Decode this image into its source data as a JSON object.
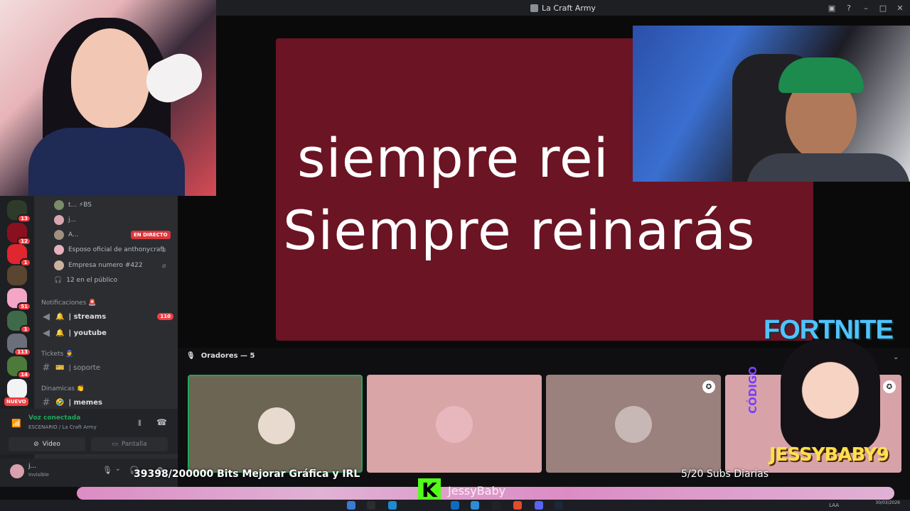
{
  "window": {
    "title": "La Craft Army"
  },
  "stage": {
    "lyric_line1": "siempre rei",
    "lyric_line2": "Siempre reinarás"
  },
  "guilds": [
    {
      "badge": "13"
    },
    {
      "badge": "12"
    },
    {
      "badge": "1"
    },
    {
      "badge": ""
    },
    {
      "badge": "51"
    },
    {
      "badge": "1"
    },
    {
      "badge": "113"
    },
    {
      "badge": "14"
    },
    {
      "badge": ""
    }
  ],
  "guild_new_label": "NUEVO",
  "voice_channel_users": [
    {
      "name": "t... ⚡BS"
    },
    {
      "name": "j..."
    },
    {
      "name": "A..."
    },
    {
      "name": "Esposo oficial de anthonycraft"
    },
    {
      "name": "Empresa numero #422"
    }
  ],
  "live_label": "EN DIRECTO",
  "audience_label": "12 en el público",
  "categories": {
    "notificaciones": "Notificaciones 🚨",
    "tickets": "Tickets 👮",
    "dinamicas": "Dinamicas 👏"
  },
  "channels": {
    "streams": {
      "name": "| streams",
      "count": "110"
    },
    "youtube": {
      "name": "| youtube"
    },
    "soporte": {
      "name": "| soporte"
    },
    "memes": {
      "name": "| memes"
    }
  },
  "voice_panel": {
    "status": "Voz conectada",
    "sub": "ESCENARIO / La Craft Army",
    "video_label": "Video",
    "screen_label": "Pantalla"
  },
  "user_panel": {
    "name": "j...",
    "status": "Invisible"
  },
  "speakers": {
    "header": "Oradores — 5"
  },
  "overlays": {
    "bits": "39398/200000 Bits Mejorar Gráfica y IRL",
    "subs": "5/20 Subs Diarias",
    "kick_letter": "K",
    "streamer_name": "JessyBaby",
    "fortnite": "FORTNITE",
    "codigo": "CÓDIGO",
    "creator_code": "JESSYBABY9"
  },
  "taskbar": {
    "lang": "LAA",
    "date": "30/03/2026"
  }
}
